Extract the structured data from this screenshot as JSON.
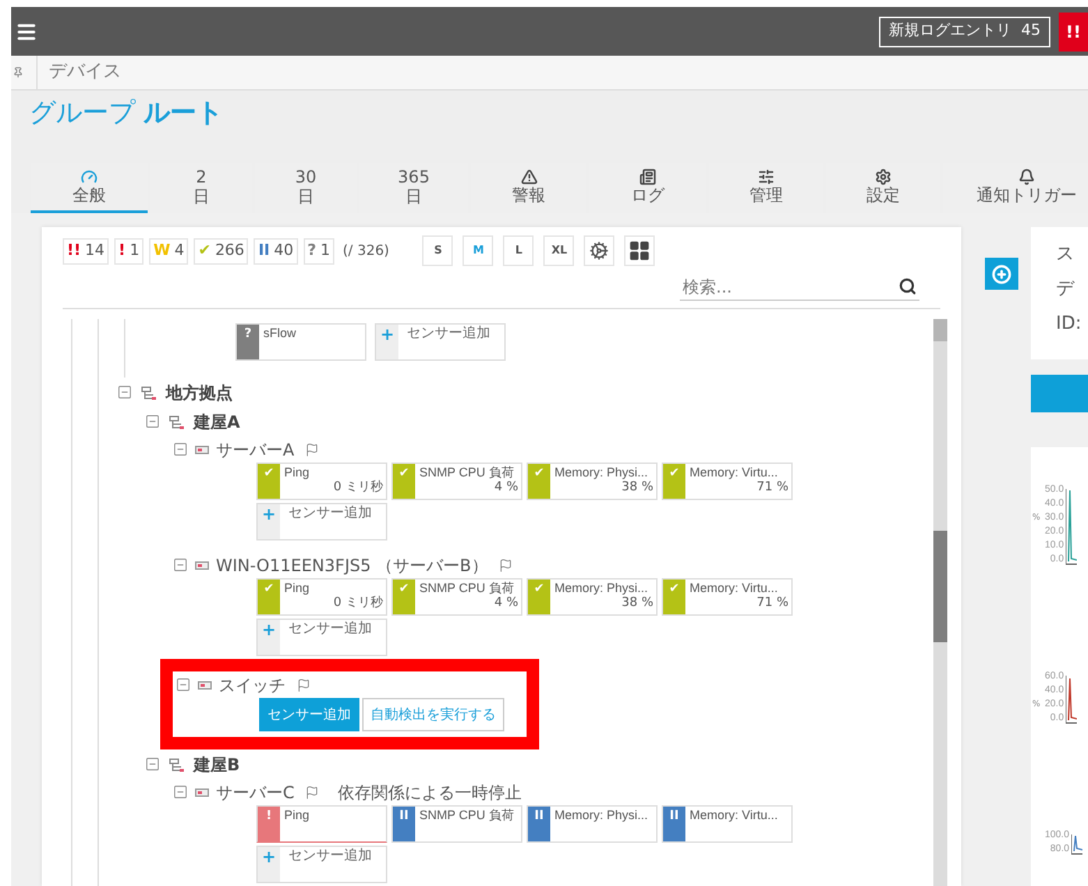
{
  "top_bar": {
    "log_button": "新規ログエントリ  45",
    "alert": "!!"
  },
  "breadcrumb": "デバイス",
  "title": "グループ **ルート**",
  "tabs": [
    {
      "label": "全般",
      "selected": true
    },
    {
      "number": "2",
      "label": "日",
      "selected": false
    },
    {
      "number": "30",
      "label": "日",
      "selected": false
    },
    {
      "number": "365",
      "label": "日",
      "selected": false
    },
    {
      "label": "警報",
      "selected": false
    },
    {
      "label": "ログ",
      "selected": false
    },
    {
      "label": "管理",
      "selected": false
    },
    {
      "label": "設定",
      "selected": false
    },
    {
      "label": "通知トリガー",
      "selected": false
    }
  ],
  "status_counts": [
    {
      "symbol": "!!",
      "count": "14",
      "color": "#e0001b"
    },
    {
      "symbol": "!",
      "count": "1",
      "color": "#e0001b"
    },
    {
      "symbol": "W",
      "count": "4",
      "color": "#f2c100"
    },
    {
      "symbol": "✔",
      "count": "266",
      "color": "#b4c216"
    },
    {
      "symbol": "II",
      "count": "40",
      "color": "#447fc1"
    },
    {
      "symbol": "?",
      "count": "1",
      "color": "#808080"
    }
  ],
  "total": "(/ 326)",
  "sizes": [
    {
      "label": "S",
      "selected": false
    },
    {
      "label": "M",
      "selected": true
    },
    {
      "label": "L",
      "selected": false
    },
    {
      "label": "XL",
      "selected": false
    }
  ],
  "search": {
    "placeholder": "検索..."
  },
  "tree": {
    "tail": {
      "sensors": [
        {
          "kind": "unknown",
          "symbol": "?",
          "name": "sFlow"
        }
      ],
      "add_sensor": {
        "symbol": "+",
        "label": "センサー追加"
      }
    },
    "nodes": [
      {
        "kind": "group",
        "name": "地方拠点",
        "expanded": true,
        "children": [
          {
            "kind": "group",
            "name": "建屋A",
            "expanded": true,
            "children": [
              {
                "kind": "device",
                "name": "サーバーA",
                "expanded": true,
                "highlighted": false,
                "sensors": [
                  {
                    "kind": "up",
                    "symbol": "✔",
                    "name": "Ping",
                    "value": "0 ミリ秒"
                  },
                  {
                    "kind": "up",
                    "symbol": "✔",
                    "name": "SNMP CPU 負荷",
                    "value": "4 %"
                  },
                  {
                    "kind": "up",
                    "symbol": "✔",
                    "name": "Memory: Physi...",
                    "value": "38 %"
                  },
                  {
                    "kind": "up",
                    "symbol": "✔",
                    "name": "Memory: Virtu...",
                    "value": "71 %"
                  }
                ],
                "add_sensor": {
                  "symbol": "+",
                  "label": "センサー追加"
                }
              },
              {
                "kind": "device",
                "name": "WIN-O11EEN3FJS5 （サーバーB）",
                "expanded": true,
                "highlighted": false,
                "sensors": [
                  {
                    "kind": "up",
                    "symbol": "✔",
                    "name": "Ping",
                    "value": "0 ミリ秒"
                  },
                  {
                    "kind": "up",
                    "symbol": "✔",
                    "name": "SNMP CPU 負荷",
                    "value": "4 %"
                  },
                  {
                    "kind": "up",
                    "symbol": "✔",
                    "name": "Memory: Physi...",
                    "value": "38 %"
                  },
                  {
                    "kind": "up",
                    "symbol": "✔",
                    "name": "Memory: Virtu...",
                    "value": "71 %"
                  }
                ],
                "add_sensor": {
                  "symbol": "+",
                  "label": "センサー追加"
                }
              },
              {
                "kind": "device",
                "name": "スイッチ",
                "expanded": true,
                "highlighted": true,
                "actions": [
                  {
                    "kind": "primary",
                    "label": "センサー追加"
                  },
                  {
                    "kind": "secondary",
                    "label": "自動検出を実行する"
                  }
                ]
              }
            ]
          },
          {
            "kind": "group",
            "name": "建屋B",
            "expanded": true,
            "children": [
              {
                "kind": "device",
                "name": "サーバーC",
                "expanded": true,
                "highlighted": false,
                "status_text": "依存関係による一時停止",
                "sensors": [
                  {
                    "kind": "down",
                    "symbol": "!",
                    "name": "Ping"
                  },
                  {
                    "kind": "paused",
                    "symbol": "II",
                    "name": "SNMP CPU 負荷"
                  },
                  {
                    "kind": "paused",
                    "symbol": "II",
                    "name": "Memory: Physi..."
                  },
                  {
                    "kind": "paused",
                    "symbol": "II",
                    "name": "Memory: Virtu..."
                  }
                ],
                "add_sensor": {
                  "symbol": "+",
                  "label": "センサー追加"
                }
              }
            ]
          }
        ]
      }
    ]
  },
  "details": {
    "lines": [
      "ス",
      "デ",
      "ID:"
    ]
  },
  "charts": [
    {
      "unit": "%",
      "ticks": [
        "50.0",
        "40.0",
        "30.0",
        "20.0",
        "10.0",
        "0.0"
      ]
    },
    {
      "unit": "%",
      "ticks": [
        "60.0",
        "40.0",
        "20.0",
        "0.0"
      ]
    },
    {
      "ticks": [
        "100.0",
        "80.0"
      ]
    }
  ]
}
